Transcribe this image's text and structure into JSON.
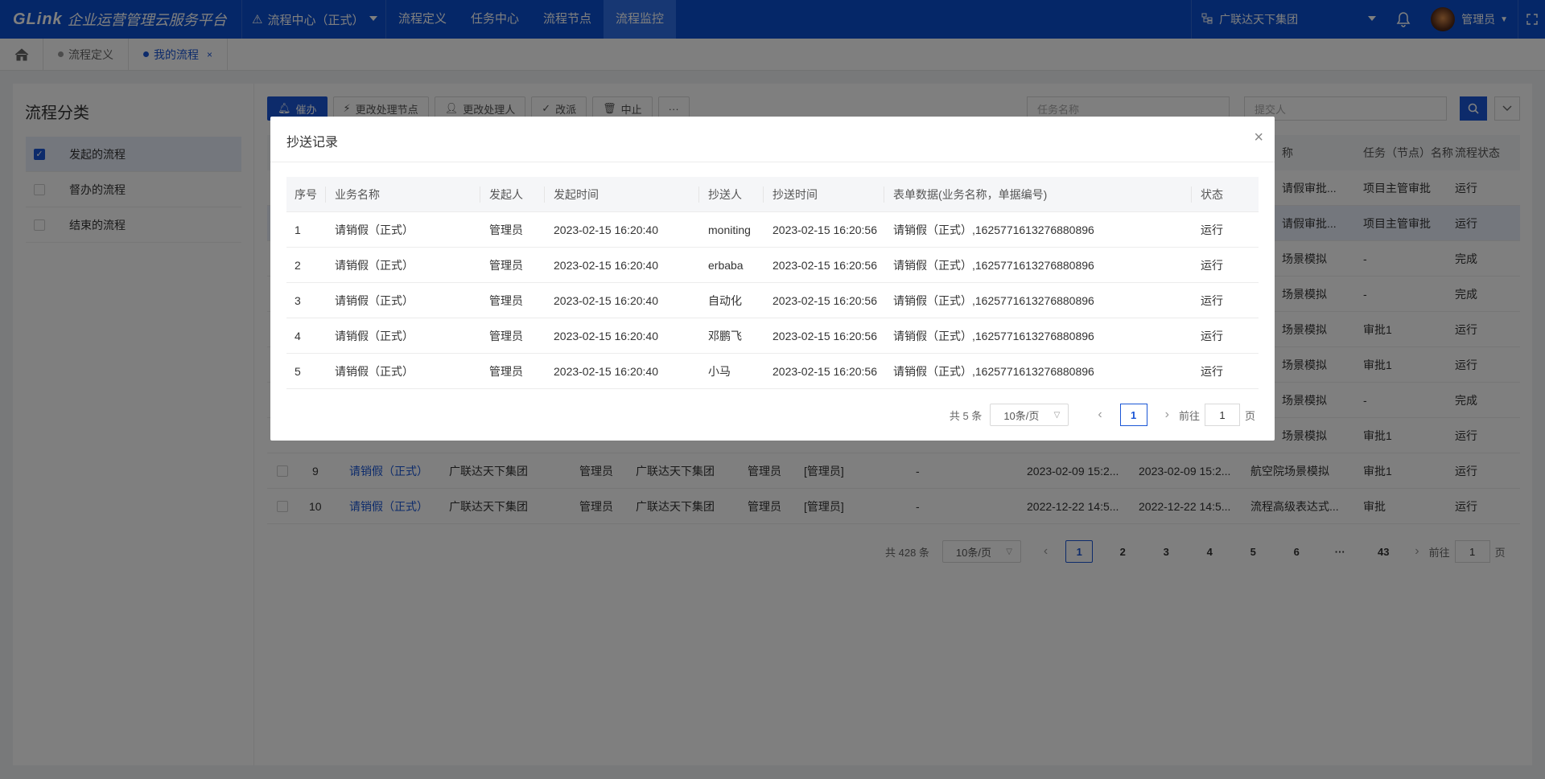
{
  "header": {
    "brand": "GLink",
    "app_name": "企业运营管理云服务平台",
    "system_selector": "流程中心（正式）",
    "nav": [
      "流程定义",
      "任务中心",
      "流程节点",
      "流程监控"
    ],
    "org": "广联达天下集团",
    "user": "管理员"
  },
  "tabs": [
    {
      "label": "流程定义"
    },
    {
      "label": "我的流程",
      "close": "×"
    }
  ],
  "sidebar": {
    "title": "流程分类",
    "items": [
      {
        "label": "发起的流程",
        "checked": true
      },
      {
        "label": "督办的流程",
        "checked": false
      },
      {
        "label": "结束的流程",
        "checked": false
      }
    ]
  },
  "toolbar": {
    "buttons": [
      "催办",
      "更改处理节点",
      "更改处理人",
      "改派",
      "中止",
      "···"
    ],
    "task_placeholder": "任务名称",
    "submitter_placeholder": "提交人"
  },
  "main_table": {
    "headers": [
      "称",
      "任务（节点）名称",
      "流程状态"
    ],
    "rows": [
      {
        "tail": "请假审批...",
        "node": "项目主管审批",
        "status": "运行"
      },
      {
        "tail": "请假审批...",
        "node": "项目主管审批",
        "status": "运行"
      },
      {
        "tail": "场景模拟",
        "node": "-",
        "status": "完成"
      },
      {
        "tail": "场景模拟",
        "node": "-",
        "status": "完成"
      },
      {
        "tail": "场景模拟",
        "node": "审批1",
        "status": "运行"
      },
      {
        "tail": "场景模拟",
        "node": "审批1",
        "status": "运行"
      },
      {
        "tail": "场景模拟",
        "node": "-",
        "status": "完成"
      },
      {
        "tail": "场景模拟",
        "node": "审批1",
        "status": "运行"
      },
      {
        "no": "9",
        "biz": "请销假（正式）",
        "org": "广联达天下集团",
        "starter": "管理员",
        "org2": "广联达天下集团",
        "handler": "管理员",
        "handlers": "[管理员]",
        "dash": "-",
        "t1": "2023-02-09 15:2...",
        "t2": "2023-02-09 15:2...",
        "tail": "航空院场景模拟",
        "node": "审批1",
        "status": "运行"
      },
      {
        "no": "10",
        "biz": "请销假（正式）",
        "org": "广联达天下集团",
        "starter": "管理员",
        "org2": "广联达天下集团",
        "handler": "管理员",
        "handlers": "[管理员]",
        "dash": "-",
        "t1": "2022-12-22 14:5...",
        "t2": "2022-12-22 14:5...",
        "tail": "流程高级表达式...",
        "node": "审批",
        "status": "运行"
      }
    ]
  },
  "main_pager": {
    "total": "共 428 条",
    "size": "10条/页",
    "pages": [
      "1",
      "2",
      "3",
      "4",
      "5",
      "6",
      "···",
      "43"
    ],
    "goto": "前往",
    "goto_value": "1",
    "unit": "页"
  },
  "modal": {
    "title": "抄送记录",
    "close": "×",
    "headers": [
      "序号",
      "业务名称",
      "发起人",
      "发起时间",
      "抄送人",
      "抄送时间",
      "表单数据(业务名称，单据编号)",
      "状态"
    ],
    "rows": [
      {
        "no": "1",
        "biz": "请销假（正式）",
        "starter": "管理员",
        "start_time": "2023-02-15 16:20:40",
        "cc": "moniting",
        "cc_time": "2023-02-15 16:20:56",
        "form": "请销假（正式）,1625771613276880896",
        "status": "运行"
      },
      {
        "no": "2",
        "biz": "请销假（正式）",
        "starter": "管理员",
        "start_time": "2023-02-15 16:20:40",
        "cc": "erbaba",
        "cc_time": "2023-02-15 16:20:56",
        "form": "请销假（正式）,1625771613276880896",
        "status": "运行"
      },
      {
        "no": "3",
        "biz": "请销假（正式）",
        "starter": "管理员",
        "start_time": "2023-02-15 16:20:40",
        "cc": "自动化",
        "cc_time": "2023-02-15 16:20:56",
        "form": "请销假（正式）,1625771613276880896",
        "status": "运行"
      },
      {
        "no": "4",
        "biz": "请销假（正式）",
        "starter": "管理员",
        "start_time": "2023-02-15 16:20:40",
        "cc": "邓鹏飞",
        "cc_time": "2023-02-15 16:20:56",
        "form": "请销假（正式）,1625771613276880896",
        "status": "运行"
      },
      {
        "no": "5",
        "biz": "请销假（正式）",
        "starter": "管理员",
        "start_time": "2023-02-15 16:20:40",
        "cc": "小马",
        "cc_time": "2023-02-15 16:20:56",
        "form": "请销假（正式）,1625771613276880896",
        "status": "运行"
      }
    ],
    "pager": {
      "total": "共 5 条",
      "size": "10条/页",
      "page": "1",
      "goto": "前往",
      "goto_value": "1",
      "unit": "页"
    }
  },
  "colors": {
    "primary": "#1a56d6",
    "topbar": "#0b4fd1"
  }
}
